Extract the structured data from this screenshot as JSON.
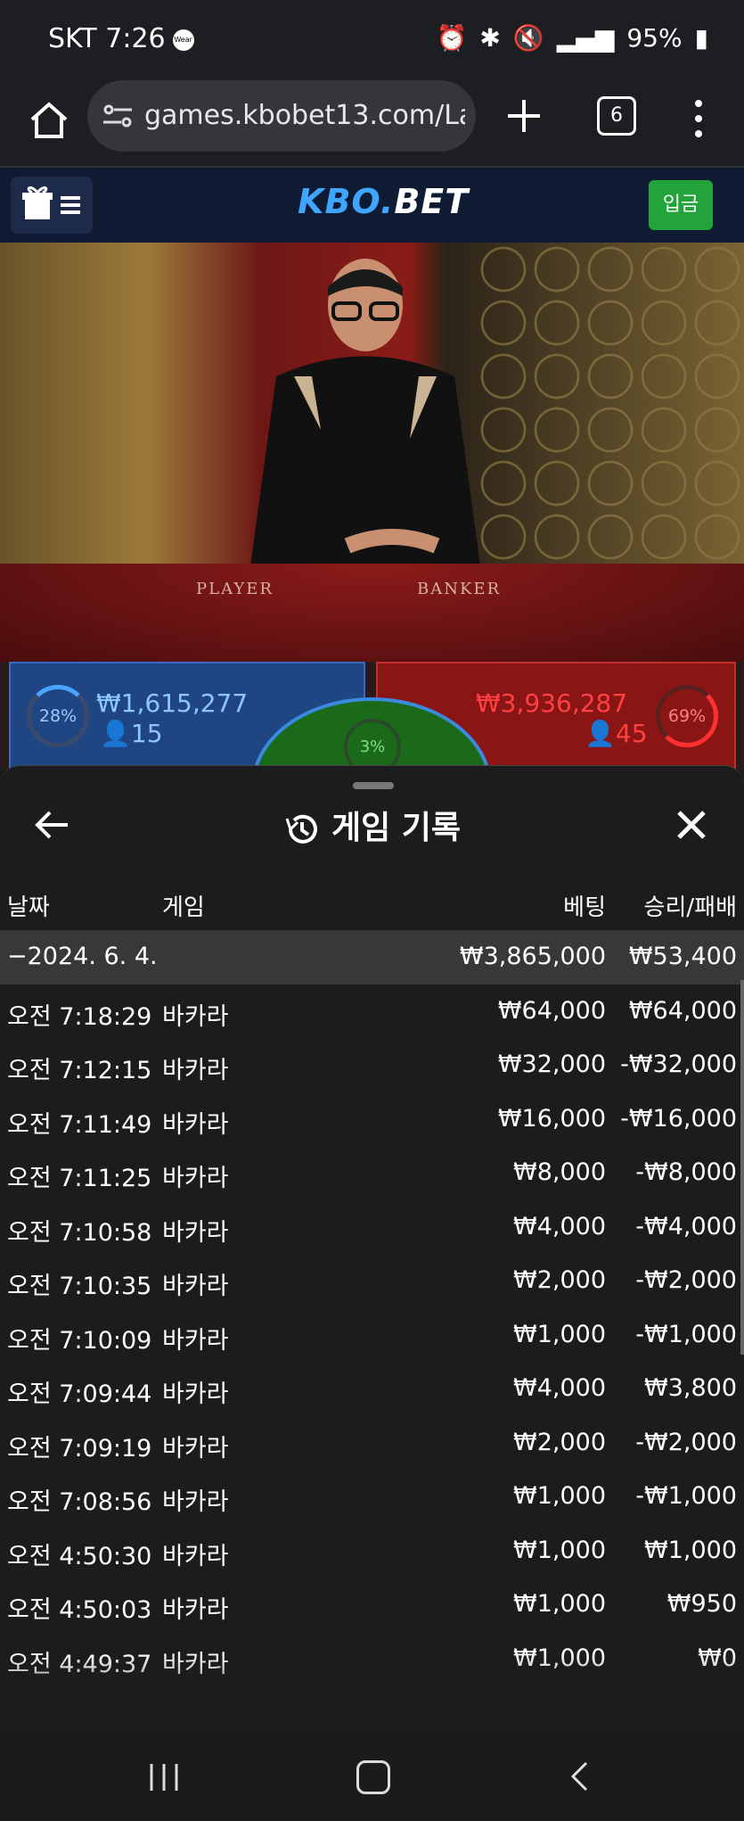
{
  "status": {
    "time": "SKT 7:26",
    "wear": "Wear",
    "battery": "95%"
  },
  "browser": {
    "url": "games.kbobet13.com/Lai",
    "tab_count": "6"
  },
  "site": {
    "logo_main": "KBO.",
    "logo_bet": "BET",
    "deposit_label": "입금"
  },
  "video": {
    "player_label": "PLAYER",
    "banker_label": "BANKER"
  },
  "bets": {
    "player": {
      "percent": "28%",
      "amount": "₩1,615,277",
      "count": "15"
    },
    "banker": {
      "percent": "69%",
      "amount": "₩3,936,287",
      "count": "45"
    },
    "tie": {
      "percent": "3%"
    }
  },
  "history": {
    "title": "게임 기록",
    "columns": {
      "date": "날짜",
      "game": "게임",
      "bet": "베팅",
      "result": "승리/패배"
    },
    "date_row": {
      "date": "−2024. 6. 4.",
      "bet": "₩3,865,000",
      "result": "₩53,400"
    },
    "rows": [
      {
        "time": "오전 7:18:29",
        "game": "바카라",
        "bet": "₩64,000",
        "result": "₩64,000"
      },
      {
        "time": "오전 7:12:15",
        "game": "바카라",
        "bet": "₩32,000",
        "result": "-₩32,000"
      },
      {
        "time": "오전 7:11:49",
        "game": "바카라",
        "bet": "₩16,000",
        "result": "-₩16,000"
      },
      {
        "time": "오전 7:11:25",
        "game": "바카라",
        "bet": "₩8,000",
        "result": "-₩8,000"
      },
      {
        "time": "오전 7:10:58",
        "game": "바카라",
        "bet": "₩4,000",
        "result": "-₩4,000"
      },
      {
        "time": "오전 7:10:35",
        "game": "바카라",
        "bet": "₩2,000",
        "result": "-₩2,000"
      },
      {
        "time": "오전 7:10:09",
        "game": "바카라",
        "bet": "₩1,000",
        "result": "-₩1,000"
      },
      {
        "time": "오전 7:09:44",
        "game": "바카라",
        "bet": "₩4,000",
        "result": "₩3,800"
      },
      {
        "time": "오전 7:09:19",
        "game": "바카라",
        "bet": "₩2,000",
        "result": "-₩2,000"
      },
      {
        "time": "오전 7:08:56",
        "game": "바카라",
        "bet": "₩1,000",
        "result": "-₩1,000"
      },
      {
        "time": "오전 4:50:30",
        "game": "바카라",
        "bet": "₩1,000",
        "result": "₩1,000"
      },
      {
        "time": "오전 4:50:03",
        "game": "바카라",
        "bet": "₩1,000",
        "result": "₩950"
      },
      {
        "time": "오전 4:49:37",
        "game": "바카라",
        "bet": "₩1,000",
        "result": "₩0"
      }
    ]
  },
  "colors": {
    "accent": "#3fa6ff",
    "deposit": "#22a43a",
    "player": "#1f4582",
    "banker": "#8a1515"
  }
}
